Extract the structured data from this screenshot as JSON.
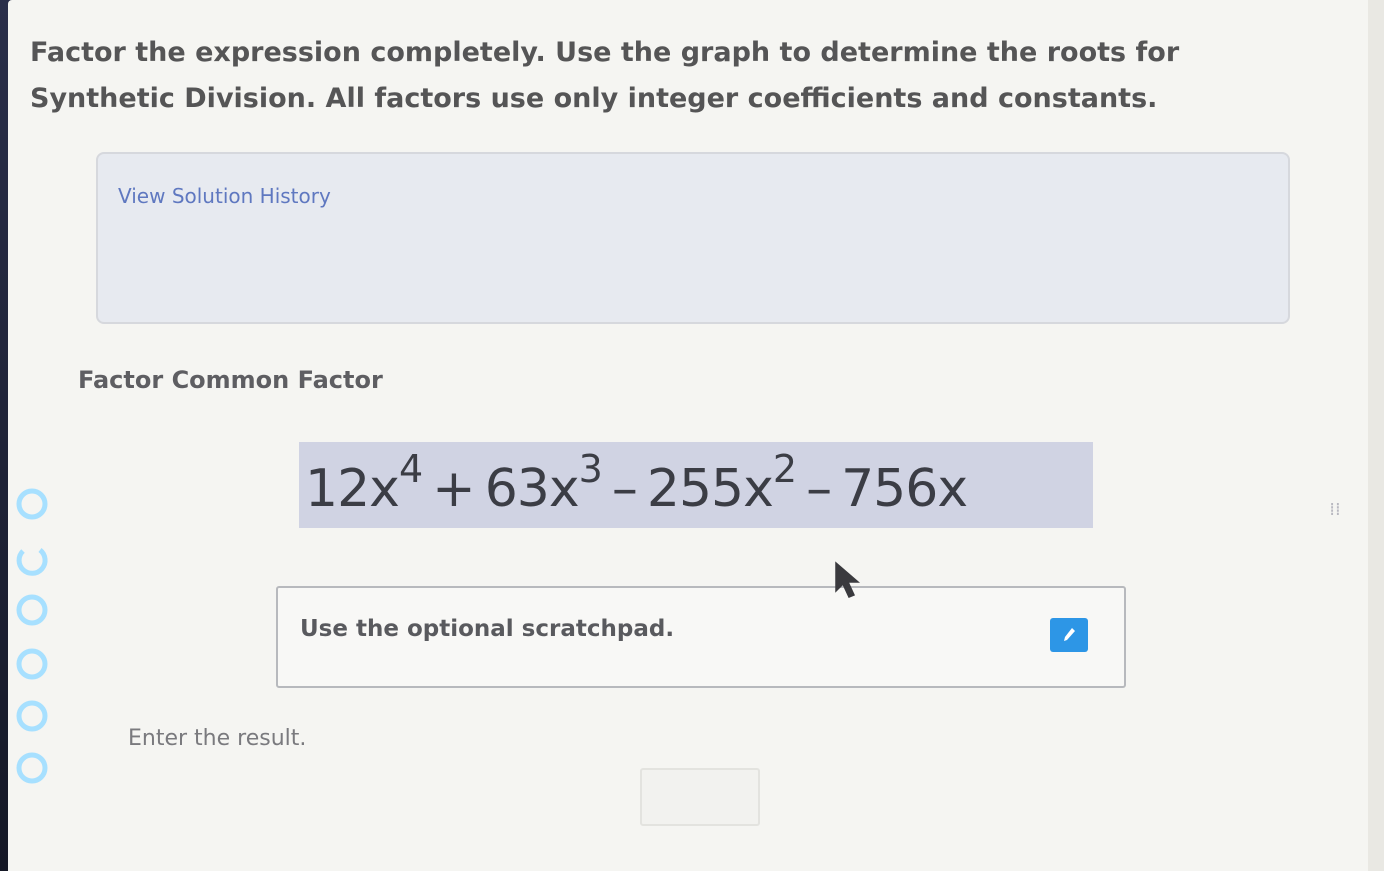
{
  "question": {
    "text": "Factor the expression completely. Use the graph to determine the roots for Synthetic Division. All factors use only integer coefficients and constants."
  },
  "history": {
    "link_label": "View Solution History"
  },
  "step": {
    "title": "Factor Common Factor"
  },
  "expression": {
    "t1_coef": "12x",
    "t1_exp": "4",
    "op1": "+",
    "t2_coef": "63x",
    "t2_exp": "3",
    "op2": "–",
    "t3_coef": "255x",
    "t3_exp": "2",
    "op3": "–",
    "t4": "756x"
  },
  "scratchpad": {
    "label": "Use the optional scratchpad.",
    "icon": "pencil-icon"
  },
  "result": {
    "label": "Enter the result.",
    "value": ""
  },
  "question_nav": {
    "icons": [
      "circle-icon",
      "circle-partial-icon",
      "circle-icon",
      "circle-icon",
      "circle-icon",
      "circle-icon"
    ]
  },
  "colors": {
    "rail": "#3d5ccd",
    "accent_button": "#2d96e6",
    "expression_highlight": "#d0d3e3",
    "link": "#5f78c0"
  }
}
